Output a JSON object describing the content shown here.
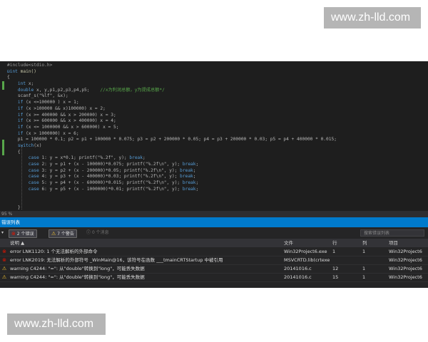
{
  "watermark": "www.zh-lld.com",
  "editor": {
    "zoom": "95 %",
    "lines": [
      [
        {
          "t": "#include<stdio.h>",
          "c": "pp"
        }
      ],
      [
        {
          "t": "⊟int ",
          "c": "kw"
        },
        {
          "t": "main()",
          "c": "fn"
        }
      ],
      [
        {
          "t": "{",
          "c": ""
        }
      ],
      [
        {
          "t": "    int ",
          "c": "kw"
        },
        {
          "t": "x;",
          "c": ""
        }
      ],
      [
        {
          "t": "    double ",
          "c": "kw"
        },
        {
          "t": "x, y,p1,p2,p3,p4,p5;    ",
          "c": ""
        },
        {
          "t": "//x为利润总额，y为提成总额*/",
          "c": "cm"
        }
      ],
      [
        {
          "t": "    scanf_s(\"%lf\", &x);",
          "c": ""
        }
      ],
      [
        {
          "t": "    if ",
          "c": "kw"
        },
        {
          "t": "(x <=100000 ) x = 1;",
          "c": ""
        }
      ],
      [
        {
          "t": "    if ",
          "c": "kw"
        },
        {
          "t": "(x >100000 && x)100000) x = 2;",
          "c": ""
        }
      ],
      [
        {
          "t": "    if ",
          "c": "kw"
        },
        {
          "t": "(x >= 400000 && x > 200000) x = 3;",
          "c": ""
        }
      ],
      [
        {
          "t": "    if ",
          "c": "kw"
        },
        {
          "t": "(x >= 600000 && x > 400000) x = 4;",
          "c": ""
        }
      ],
      [
        {
          "t": "    if ",
          "c": "kw"
        },
        {
          "t": "(x <= 1000000 && x > 600000) x = 5;",
          "c": ""
        }
      ],
      [
        {
          "t": "    if ",
          "c": "kw"
        },
        {
          "t": "(x > 1000000) x = 6;",
          "c": ""
        }
      ],
      [
        {
          "t": "    p1 = 100000 * 0.1; p2 = p1 + 100000 * 0.075; p3 = p2 + 200000 * 0.05; p4 = p3 + 200000 * 0.03; p5 = p4 + 400000 * 0.015;",
          "c": ""
        }
      ],
      [
        {
          "t": "    switch",
          "c": "kw"
        },
        {
          "t": "(x)",
          "c": ""
        }
      ],
      [
        {
          "t": "    {",
          "c": ""
        }
      ],
      [
        {
          "t": "        case ",
          "c": "kw"
        },
        {
          "t": "1: y = x*0.1; printf(\"%.2f\", y); ",
          "c": ""
        },
        {
          "t": "break",
          "c": "kw"
        },
        {
          "t": ";",
          "c": ""
        }
      ],
      [
        {
          "t": "        case ",
          "c": "kw"
        },
        {
          "t": "2: y = p1 + (x - 100000)*0.075; printf(\"%.2f\\n\", y); ",
          "c": ""
        },
        {
          "t": "break",
          "c": "kw"
        },
        {
          "t": ";",
          "c": ""
        }
      ],
      [
        {
          "t": "        case ",
          "c": "kw"
        },
        {
          "t": "3: y = p2 + (x - 200000)*0.05; printf(\"%.2f\\n\", y); ",
          "c": ""
        },
        {
          "t": "break",
          "c": "kw"
        },
        {
          "t": ";",
          "c": ""
        }
      ],
      [
        {
          "t": "        case ",
          "c": "kw"
        },
        {
          "t": "4: y = p3 + (x - 400000)*0.03; printf(\"%.2f\\n\", y); ",
          "c": ""
        },
        {
          "t": "break",
          "c": "kw"
        },
        {
          "t": ";",
          "c": ""
        }
      ],
      [
        {
          "t": "        case ",
          "c": "kw"
        },
        {
          "t": "5: y = p4 + (x - 600000)*0.015; printf(\"%.2f\\n\", y); ",
          "c": ""
        },
        {
          "t": "break",
          "c": "kw"
        },
        {
          "t": ";",
          "c": ""
        }
      ],
      [
        {
          "t": "        case ",
          "c": "kw"
        },
        {
          "t": "6: y = p5 + (x - 1000000)*0.01; printf(\"%.2f\\n\", y); ",
          "c": ""
        },
        {
          "t": "break",
          "c": "kw"
        },
        {
          "t": ";",
          "c": ""
        }
      ],
      [
        {
          "t": "",
          "c": ""
        }
      ],
      [
        {
          "t": "",
          "c": ""
        }
      ],
      [
        {
          "t": "    }",
          "c": ""
        }
      ]
    ]
  },
  "error_list": {
    "title": "错误列表",
    "dropdown_arrow": "▾",
    "filters": {
      "errors": "2 个错误",
      "warnings": "7 个警告",
      "messages": "0 个消息"
    },
    "search_placeholder": "搜索错误列表",
    "columns": {
      "desc": "说明",
      "file": "文件",
      "line": "行",
      "col": "列",
      "project": "项目"
    },
    "rows": [
      {
        "type": "error",
        "desc": "error LNK1120: 1 个无法解析的外部命令",
        "file": "Win32Project6.exe",
        "line": "1",
        "col": "1",
        "project": "Win32Project6"
      },
      {
        "type": "error",
        "desc": "error LNK2019: 无法解析的外部符号 _WinMain@16，该符号在函数 ___tmainCRTStartup 中被引用",
        "file": "MSVCRTD.lib(crtexe",
        "line": "",
        "col": "",
        "project": "Win32Project6"
      },
      {
        "type": "warning",
        "desc": "warning C4244: \"=\": 从\"double\"转换到\"long\"，可能丢失数据",
        "file": "20141016.c",
        "line": "12",
        "col": "1",
        "project": "Win32Project6"
      },
      {
        "type": "warning",
        "desc": "warning C4244: \"=\": 从\"double\"转换到\"long\"，可能丢失数据",
        "file": "20141016.c",
        "line": "15",
        "col": "1",
        "project": "Win32Project6"
      }
    ]
  }
}
